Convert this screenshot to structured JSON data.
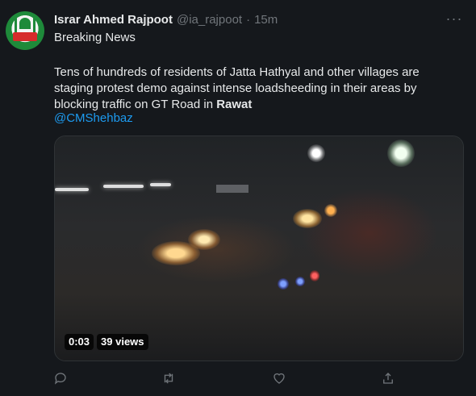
{
  "tweet": {
    "author_name": "Israr Ahmed Rajpoot",
    "handle": "@ia_rajpoot",
    "separator": "·",
    "time": "15m",
    "more_label": "···",
    "first_line": "Breaking News",
    "body_text_before": "Tens of hundreds of residents of Jatta Hathyal and other villages are staging protest demo against intense loadsheeding in their areas by blocking traffic on GT Road in ",
    "body_text_bold": "Rawat",
    "mention": "@CMShehbaz"
  },
  "video": {
    "duration": "0:03",
    "views": "39 views"
  },
  "icons": {
    "reply": "reply-icon",
    "retweet": "retweet-icon",
    "like": "heart-icon",
    "share": "share-icon",
    "more": "more-icon"
  },
  "colors": {
    "background": "#15181c",
    "text": "#e7e9ea",
    "secondary": "#71767b",
    "link": "#1d9bf0"
  }
}
